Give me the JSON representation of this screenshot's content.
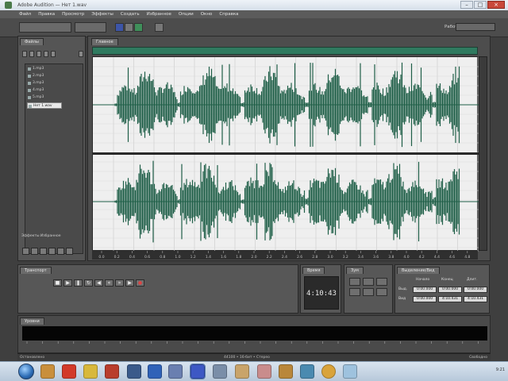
{
  "titlebar": {
    "title": "Adobe Audition — Нет 1.wav"
  },
  "menubar": {
    "items": [
      "Файл",
      "Правка",
      "Просмотр",
      "Эффекты",
      "Создать",
      "Избранное",
      "Опции",
      "Окно",
      "Справка"
    ]
  },
  "toolbar": {
    "workspace_label": "Рабочая среда:",
    "workspace_value": "Редактирование"
  },
  "files_panel": {
    "tab_label": "Файлы",
    "files": [
      "1.mp3",
      "2.mp3",
      "3.mp3",
      "4.mp3",
      "5.mp3",
      "Нет 1.wav"
    ],
    "selected_index": 5,
    "footer_label": "Эффекты Избранное"
  },
  "main_panel": {
    "tab_label": "Главное",
    "timeline_ticks": [
      "0.0",
      "0.2",
      "0.4",
      "0.6",
      "0.8",
      "1.0",
      "1.2",
      "1.4",
      "1.6",
      "1.8",
      "2.0",
      "2.2",
      "2.4",
      "2.6",
      "2.8",
      "3.0",
      "3.2",
      "3.4",
      "3.6",
      "3.8",
      "4.0",
      "4.2",
      "4.4",
      "4.6",
      "4.8"
    ]
  },
  "transport": {
    "tab_label": "Транспорт"
  },
  "time": {
    "tab_label": "Время",
    "value": "4:10:43"
  },
  "zoom": {
    "tab_label": "Зум"
  },
  "selection": {
    "tab_label": "Выделение/Вид",
    "headers": [
      "Начало",
      "Конец",
      "Длит."
    ],
    "rows": [
      {
        "label": "Выд.",
        "values": [
          "0:00.000",
          "0:00.000",
          "0:00.000"
        ]
      },
      {
        "label": "Вид",
        "values": [
          "0:00.000",
          "4:10.431",
          "4:10.431"
        ]
      }
    ]
  },
  "levels": {
    "tab_label": "Уровни"
  },
  "statusbar": {
    "left": "Остановлено",
    "mid": "44100 • 16-бит • Стерео",
    "right": "Свободно"
  },
  "taskbar": {
    "clock": "9:21"
  },
  "colors": {
    "waveform": "#1f5f48",
    "overview": "#2f7a5f",
    "wave_bg": "#efefef"
  }
}
